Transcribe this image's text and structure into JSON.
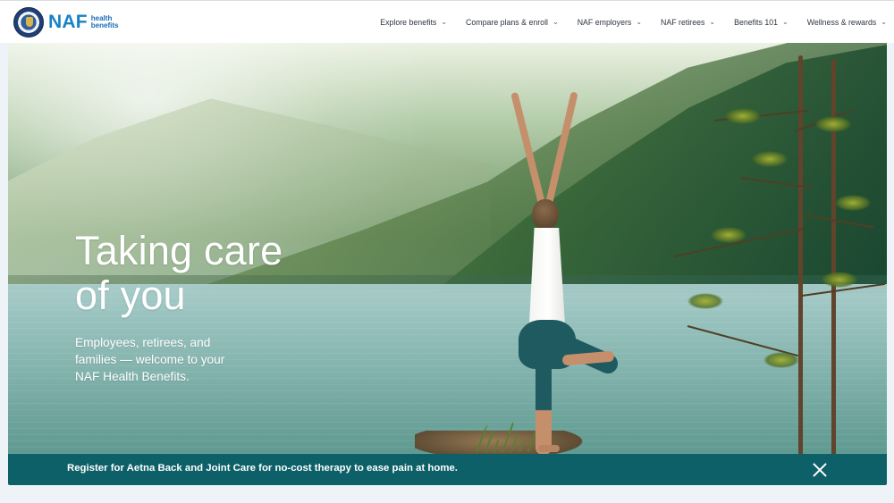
{
  "header": {
    "logo": {
      "brand": "NAF",
      "subtitle": "health benefits",
      "seal_icon": "department-seal-icon"
    },
    "nav": [
      {
        "label": "Explore benefits",
        "icon": "chevron-down-icon"
      },
      {
        "label": "Compare plans & enroll",
        "icon": "chevron-down-icon"
      },
      {
        "label": "NAF employers",
        "icon": "chevron-down-icon"
      },
      {
        "label": "NAF retirees",
        "icon": "chevron-down-icon"
      },
      {
        "label": "Benefits 101",
        "icon": "chevron-down-icon"
      },
      {
        "label": "Wellness & rewards",
        "icon": "chevron-down-icon"
      }
    ]
  },
  "hero": {
    "title": "Taking care of you",
    "text": "Employees, retirees, and families — welcome to your NAF Health Benefits.",
    "image": "woman-doing-yoga-by-mountain-lake",
    "colors": {
      "text": "#ffffff",
      "lake": "#8fc0bb",
      "forest": "#2f6742"
    }
  },
  "banner": {
    "text": "Register for Aetna Back and Joint Care for no-cost therapy to ease pain at home.",
    "close_icon": "close-icon",
    "color": "#0d6068"
  }
}
